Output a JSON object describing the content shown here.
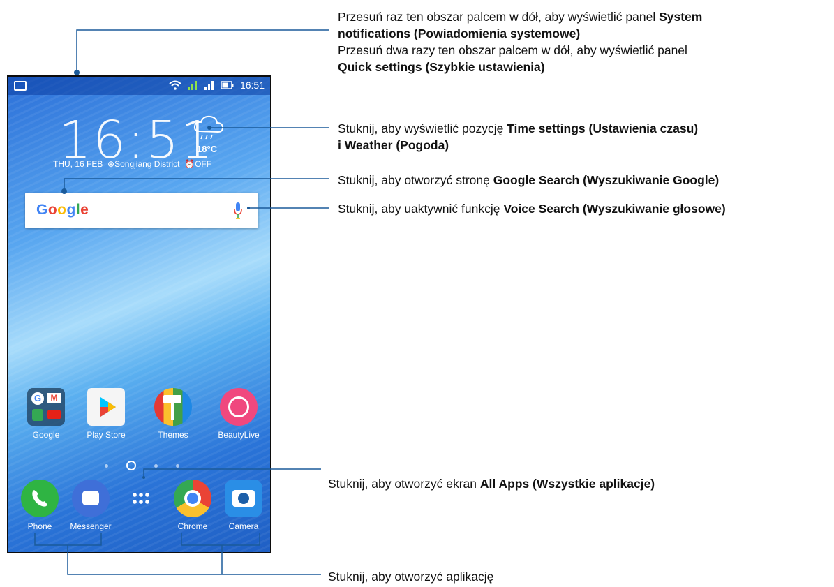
{
  "status_bar": {
    "time": "16:51"
  },
  "clock": {
    "time": "16:51",
    "date": "THU, 16 FEB",
    "location": "Songjiang District",
    "alarm": "OFF"
  },
  "weather": {
    "temp": "18°C"
  },
  "search": {
    "logo": "Google"
  },
  "apps_row": [
    {
      "label": "Google",
      "icon": "google-folder-icon"
    },
    {
      "label": "Play Store",
      "icon": "play-store-icon"
    },
    {
      "label": "Themes",
      "icon": "themes-icon"
    },
    {
      "label": "BeautyLive",
      "icon": "beautylive-icon"
    }
  ],
  "dock": [
    {
      "label": "Phone",
      "icon": "phone-icon"
    },
    {
      "label": "Messenger",
      "icon": "messenger-icon"
    },
    {
      "label": "",
      "icon": "all-apps-icon"
    },
    {
      "label": "Chrome",
      "icon": "chrome-icon"
    },
    {
      "label": "Camera",
      "icon": "camera-icon"
    }
  ],
  "annotations": {
    "a1_text1": "Przesuń raz ten obszar palcem w dół, aby wyświetlić panel ",
    "a1_bold1": "System",
    "a1_bold2": "notifications (Powiadomienia systemowe)",
    "a1_text2": "Przesuń dwa razy ten obszar palcem w dół, aby wyświetlić panel",
    "a1_bold3": "Quick settings (Szybkie ustawienia)",
    "a2_text": "Stuknij, aby wyświetlić pozycję ",
    "a2_bold1": "Time settings (Ustawienia czasu)",
    "a2_bold2": "i Weather (Pogoda)",
    "a3_text": "Stuknij, aby otworzyć stronę ",
    "a3_bold": "Google Search (Wyszukiwanie Google)",
    "a4_text": "Stuknij, aby uaktywnić funkcję ",
    "a4_bold": "Voice Search (Wyszukiwanie głosowe)",
    "a5_text": "Stuknij, aby otworzyć ekran ",
    "a5_bold": "All Apps (Wszystkie aplikacje)",
    "a6_text": "Stuknij, aby otworzyć aplikację"
  },
  "colors": {
    "line": "#1a5a9a"
  }
}
